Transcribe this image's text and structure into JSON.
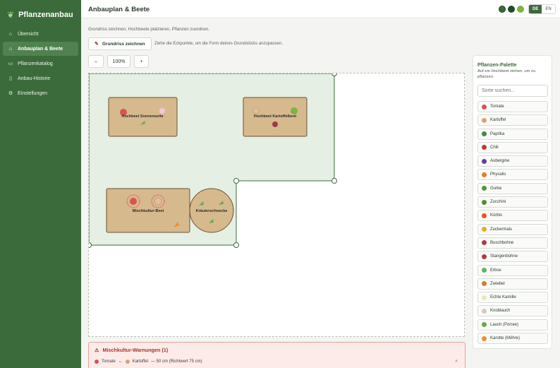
{
  "app": {
    "name": "Pflanzenanbau",
    "logo_icon": "sprout-icon"
  },
  "sidebar": {
    "items": [
      {
        "label": "Übersicht",
        "icon": "home-icon"
      },
      {
        "label": "Anbauplan & Beete",
        "icon": "plan-icon",
        "active": true
      },
      {
        "label": "Pflanzenkatalog",
        "icon": "book-icon"
      },
      {
        "label": "Anbau-Historie",
        "icon": "history-icon"
      },
      {
        "label": "Einstellungen",
        "icon": "gear-icon"
      }
    ]
  },
  "header": {
    "title": "Anbauplan & Beete",
    "theme_colors": [
      "#3b6b3b",
      "#1f4d2a",
      "#7cb342"
    ],
    "lang_de": "DE",
    "lang_en": "EN"
  },
  "main": {
    "subtitle": "Grundriss zeichnen, Hochbeete platzieren, Pflanzen zuordnen.",
    "draw_button": "Grundriss zeichnen",
    "hint": "Ziehe die Eckpunkte, um die Form deines Grundstücks anzupassen.",
    "zoom_out": "–",
    "zoom_level": "100%",
    "zoom_in": "+"
  },
  "beds": [
    {
      "label": "Hochbeet Sonnenseite"
    },
    {
      "label": "Hochbeet Kartoffelbeet"
    },
    {
      "label": "Mischkultur-Beet"
    },
    {
      "label": "Kräuterschnecke"
    }
  ],
  "warnings": {
    "title": "Mischkultur-Warnungen (1)",
    "plant_a": "Tomate",
    "separator": "↔",
    "plant_b": "Kartoffel",
    "detail": "— 50 cm (Richtwert 75 cm)"
  },
  "palette": {
    "title": "Pflanzen-Palette",
    "description": "Auf ein Hochbeet ziehen, um zu pflanzen.",
    "search_placeholder": "Sorte suchen...",
    "items": [
      {
        "label": "Tomate",
        "color": "#d9534f"
      },
      {
        "label": "Kartoffel",
        "color": "#d9a273"
      },
      {
        "label": "Paprika",
        "color": "#3c8d3c"
      },
      {
        "label": "Chili",
        "color": "#c0392b"
      },
      {
        "label": "Aubergine",
        "color": "#6a3d9a"
      },
      {
        "label": "Physalis",
        "color": "#e67e22"
      },
      {
        "label": "Gurke",
        "color": "#4a9a3a"
      },
      {
        "label": "Zucchini",
        "color": "#4e8f2c"
      },
      {
        "label": "Kürbis",
        "color": "#e25822"
      },
      {
        "label": "Zuckermais",
        "color": "#e0b020"
      },
      {
        "label": "Buschbohne",
        "color": "#b03a48"
      },
      {
        "label": "Stangenbohne",
        "color": "#b03a48"
      },
      {
        "label": "Erbse",
        "color": "#5cb85c"
      },
      {
        "label": "Zwiebel",
        "color": "#c9822b"
      },
      {
        "label": "Echte Kamille",
        "color": "#f2e6b3"
      },
      {
        "label": "Knoblauch",
        "color": "#d8c8c0"
      },
      {
        "label": "Lauch (Porree)",
        "color": "#6aa84f"
      },
      {
        "label": "Karotte (Möhre)",
        "color": "#f28c28"
      }
    ]
  }
}
